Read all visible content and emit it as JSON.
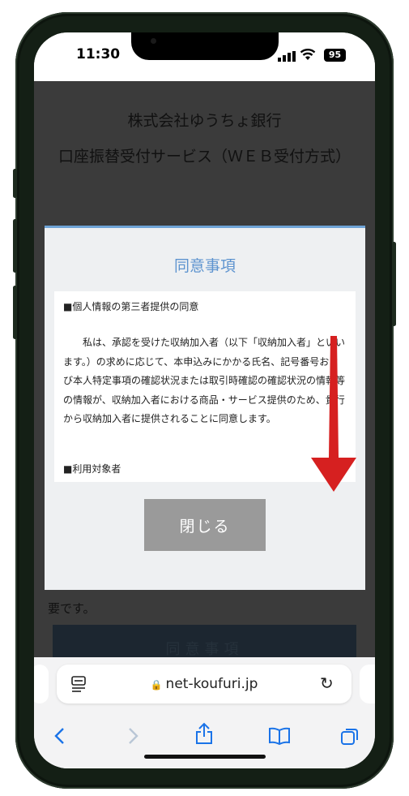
{
  "status": {
    "time": "11:30",
    "battery": "95"
  },
  "page": {
    "bank_name": "株式会社ゆうちょ銀行",
    "service_title": "口座振替受付サービス（ＷＥＢ受付方式）",
    "bottom_text": "部の収納機関を除く）とキャッシュカードの暗証番号が必要です。",
    "agree_button": "同意事項"
  },
  "modal": {
    "title": "同意事項",
    "section1_heading": "■個人情報の第三者提供の同意",
    "section1_text": "私は、承認を受けた収納加入者（以下「収納加入者」といいます。）の求めに応じて、本申込みにかかる氏名、記号番号および本人特定事項の確認状況または取引時確認の確認状況の情報等の情報が、収納加入者における商品・サービス提供のため、貴行から収納加入者に提供されることに同意します。",
    "section2_heading": "■利用対象者",
    "close_button": "閉じる"
  },
  "browser": {
    "url": "net-koufuri.jp",
    "icons": [
      "reader-icon",
      "lock-icon",
      "reload-icon",
      "back-icon",
      "forward-icon",
      "share-icon",
      "bookmarks-icon",
      "tabs-icon"
    ]
  },
  "colors": {
    "accent": "#5d93cf",
    "arrow": "#d62020",
    "overlay": "#3b3b3b"
  }
}
